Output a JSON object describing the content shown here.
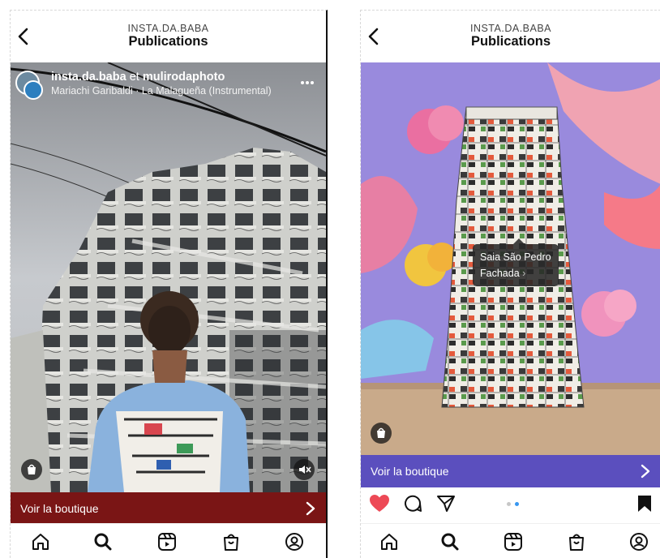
{
  "left": {
    "header": {
      "username": "INSTA.DA.BABA",
      "title": "Publications"
    },
    "post": {
      "author": "insta.da.baba",
      "connector": "et",
      "coauthor": "mulirodaphoto",
      "music": "Mariachi Garibaldi · La Malagueña (Instrumental)"
    },
    "cta": {
      "label": "Voir la boutique",
      "color": "#7a1515"
    }
  },
  "right": {
    "header": {
      "username": "INSTA.DA.BABA",
      "title": "Publications"
    },
    "tag": {
      "line1": "Saia São Pedro",
      "line2": "Fachada"
    },
    "cta": {
      "label": "Voir la boutique",
      "color": "#5b4fbe"
    },
    "carousel": {
      "count": 2,
      "active": 2
    }
  },
  "icons": {
    "back": "chevron-left-icon",
    "more": "more-icon",
    "shop": "shopping-bag-icon",
    "mute": "speaker-muted-icon",
    "like": "heart-filled-icon",
    "comment": "comment-icon",
    "share": "paper-plane-icon",
    "save": "bookmark-filled-icon",
    "nav": [
      "home-icon",
      "search-icon",
      "reels-icon",
      "shop-icon",
      "profile-icon"
    ]
  },
  "colors": {
    "like": "#ed4956",
    "carousel_active": "#3897f0"
  }
}
